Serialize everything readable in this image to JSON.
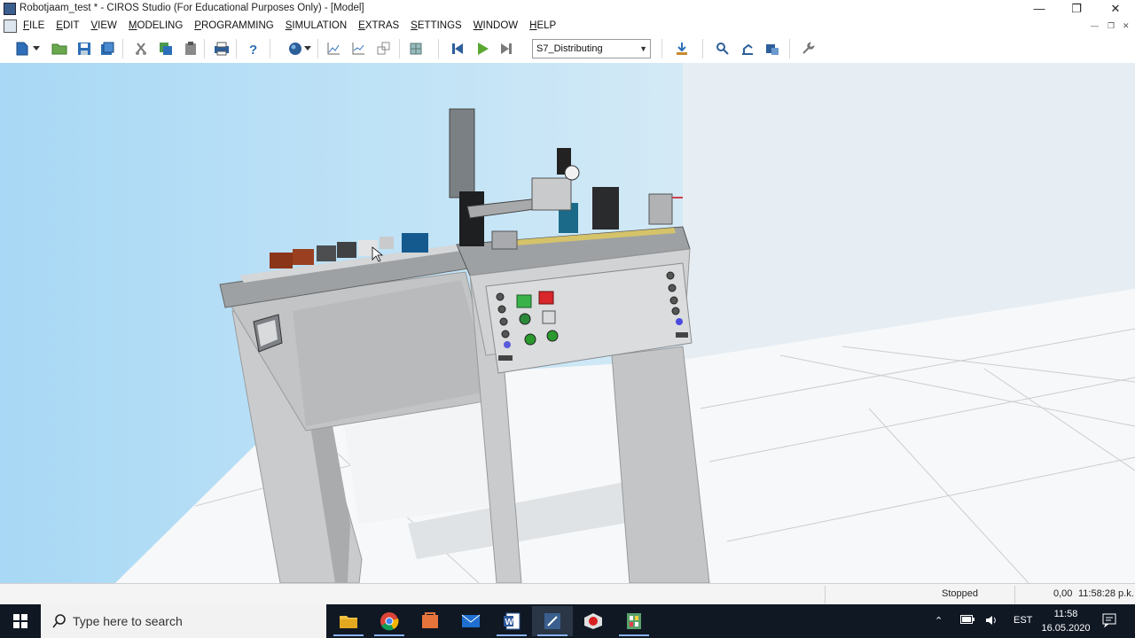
{
  "window": {
    "title": "Robotjaam_test * - CIROS Studio (For Educational Purposes Only) - [Model]",
    "controls": [
      "minimize-icon",
      "restore-icon",
      "close-icon"
    ]
  },
  "menu": {
    "items": [
      {
        "first": "F",
        "rest": "ILE"
      },
      {
        "first": "E",
        "rest": "DIT"
      },
      {
        "first": "V",
        "rest": "IEW"
      },
      {
        "first": "M",
        "rest": "ODELING"
      },
      {
        "first": "P",
        "rest": "ROGRAMMING"
      },
      {
        "first": "S",
        "rest": "IMULATION"
      },
      {
        "first": "E",
        "rest": "XTRAS"
      },
      {
        "first": "S",
        "rest": "ETTINGS"
      },
      {
        "first": "W",
        "rest": "INDOW"
      },
      {
        "first": "H",
        "rest": "ELP"
      }
    ]
  },
  "toolbar": {
    "station_select": "S7_Distributing"
  },
  "status": {
    "state": "Stopped",
    "value": "0,00",
    "time": "11:58:28 p.k."
  },
  "taskbar": {
    "search_placeholder": "Type here to search",
    "language": "EST",
    "clock_time": "11:58",
    "clock_date": "16.05.2020"
  }
}
